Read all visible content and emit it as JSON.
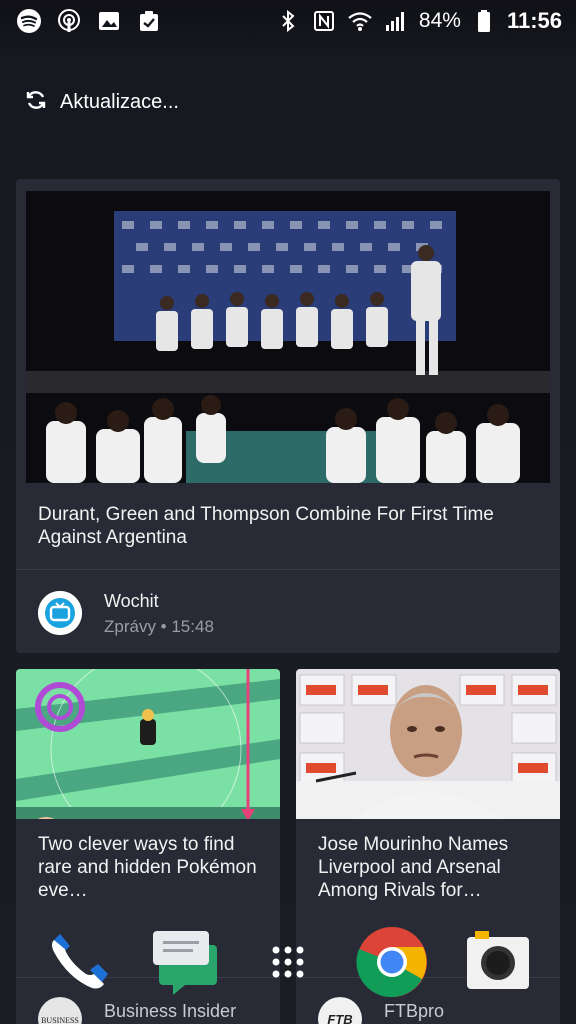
{
  "status_bar": {
    "battery": "84%",
    "time": "11:56",
    "left_icons": [
      "spotify-icon",
      "podcast-icon",
      "image-icon",
      "task-icon"
    ],
    "right_icons": [
      "bluetooth-icon",
      "nfc-icon",
      "wifi-icon",
      "signal-icon",
      "battery-icon"
    ]
  },
  "refresh": {
    "label": "Aktualizace...",
    "icon": "refresh-icon"
  },
  "feed": {
    "main_card": {
      "title": "Durant, Green and Thompson Combine For First Time Against Argentina",
      "source": "Wochit",
      "meta": "Zprávy • 15:48"
    },
    "cards": [
      {
        "title": "Two clever ways to find rare and hidden Pokémon eve…",
        "source": "Business Insider",
        "logo_text": "BUSINESS"
      },
      {
        "title": "Jose Mourinho Names Liverpool and Arsenal Among Rivals for…",
        "source": "FTBpro",
        "logo_text": "FTB"
      }
    ]
  },
  "dock": {
    "apps": [
      "phone-icon",
      "messages-icon",
      "app-drawer-icon",
      "chrome-icon",
      "camera-icon"
    ]
  },
  "colors": {
    "background": "#171920",
    "card": "#282b35",
    "secondary_text": "#9a9ca5"
  }
}
